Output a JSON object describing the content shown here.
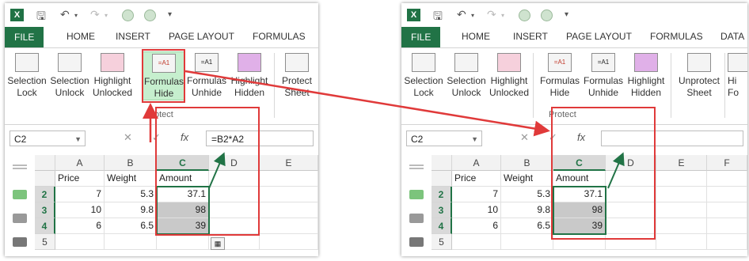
{
  "left": {
    "tabs": [
      "FILE",
      "HOME",
      "INSERT",
      "PAGE LAYOUT",
      "FORMULAS"
    ],
    "ribbon": {
      "buttons": [
        {
          "line1": "Selection",
          "line2": "Lock"
        },
        {
          "line1": "Selection",
          "line2": "Unlock"
        },
        {
          "line1": "Highlight",
          "line2": "Unlocked"
        },
        {
          "line1": "Formulas",
          "line2": "Hide"
        },
        {
          "line1": "Formulas",
          "line2": "Unhide"
        },
        {
          "line1": "Highlight",
          "line2": "Hidden"
        },
        {
          "line1": "Protect",
          "line2": "Sheet"
        }
      ],
      "group_label": "Protect",
      "icon_text": "=A1"
    },
    "name_box": "C2",
    "formula": "=B2*A2",
    "columns": [
      "A",
      "B",
      "C",
      "D",
      "E"
    ],
    "rows": [
      "2",
      "3",
      "4",
      "5"
    ],
    "header_row": [
      "Price",
      "Weight",
      "Amount"
    ],
    "data": [
      [
        "7",
        "5.3",
        "37.1"
      ],
      [
        "10",
        "9.8",
        "98"
      ],
      [
        "6",
        "6.5",
        "39"
      ]
    ]
  },
  "right": {
    "tabs": [
      "FILE",
      "HOME",
      "INSERT",
      "PAGE LAYOUT",
      "FORMULAS",
      "DATA"
    ],
    "ribbon": {
      "buttons": [
        {
          "line1": "Selection",
          "line2": "Lock"
        },
        {
          "line1": "Selection",
          "line2": "Unlock"
        },
        {
          "line1": "Highlight",
          "line2": "Unlocked"
        },
        {
          "line1": "Formulas",
          "line2": "Hide"
        },
        {
          "line1": "Formulas",
          "line2": "Unhide"
        },
        {
          "line1": "Highlight",
          "line2": "Hidden"
        },
        {
          "line1": "Unprotect",
          "line2": "Sheet"
        },
        {
          "line1": "Hi",
          "line2": "Fo"
        }
      ],
      "group_label": "Protect",
      "icon_text": "=A1"
    },
    "name_box": "C2",
    "formula": "",
    "columns": [
      "A",
      "B",
      "C",
      "D",
      "E",
      "F"
    ],
    "rows": [
      "2",
      "3",
      "4",
      "5"
    ],
    "header_row": [
      "Price",
      "Weight",
      "Amount"
    ],
    "data": [
      [
        "7",
        "5.3",
        "37.1"
      ],
      [
        "10",
        "9.8",
        "98"
      ],
      [
        "6",
        "6.5",
        "39"
      ]
    ]
  },
  "colors": {
    "excel_green": "#217346",
    "annotation_red": "#e03a3a",
    "selected_ribbon": "#c6efce"
  },
  "icons": [
    "excel-logo-icon",
    "save-icon",
    "undo-icon",
    "redo-icon",
    "fx-icon",
    "cancel-icon",
    "enter-icon",
    "paste-options-icon"
  ]
}
